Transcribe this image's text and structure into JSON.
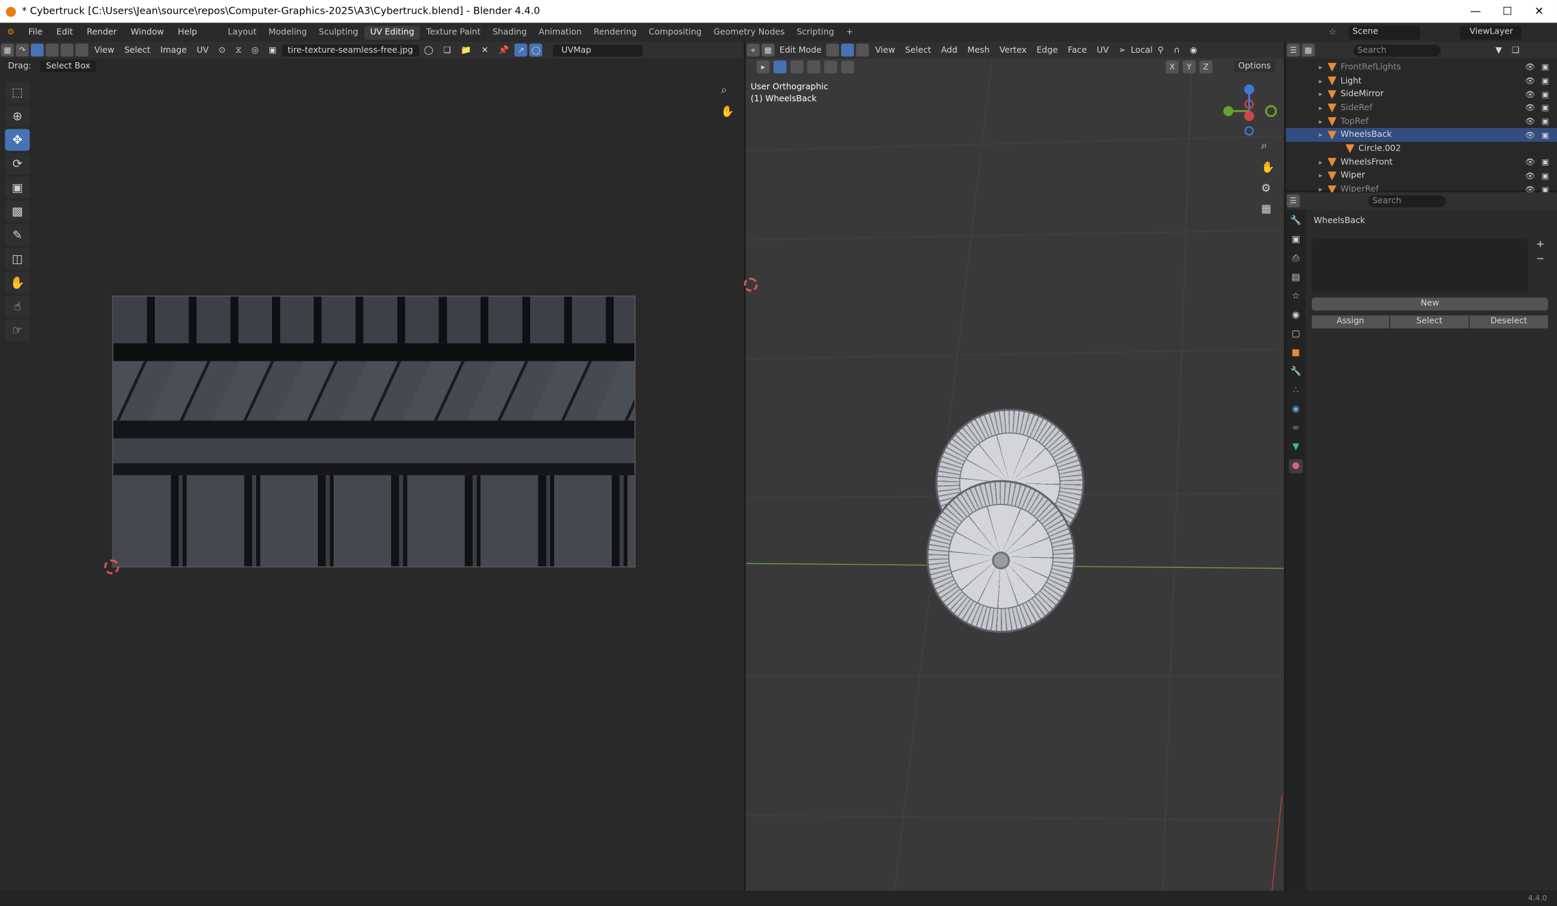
{
  "title": {
    "text": "* Cybertruck [C:\\Users\\Jean\\source\\repos\\Computer-Graphics-2025\\A3\\Cybertruck.blend] - Blender 4.4.0"
  },
  "menus": [
    "File",
    "Edit",
    "Render",
    "Window",
    "Help"
  ],
  "workspaces": [
    "Layout",
    "Modeling",
    "Sculpting",
    "UV Editing",
    "Texture Paint",
    "Shading",
    "Animation",
    "Rendering",
    "Compositing",
    "Geometry Nodes",
    "Scripting"
  ],
  "active_workspace": "UV Editing",
  "scene": {
    "label": "Scene",
    "view_layer": "ViewLayer"
  },
  "uv_editor": {
    "menus": [
      "View",
      "Select",
      "Image",
      "UV"
    ],
    "image_name": "tire-texture-seamless-free.jpg",
    "uv_map": "UVMap",
    "drag_label": "Drag:",
    "drag_mode": "Select Box"
  },
  "viewport": {
    "mode": "Edit Mode",
    "menus": [
      "View",
      "Select",
      "Add",
      "Mesh",
      "Vertex",
      "Edge",
      "Face",
      "UV"
    ],
    "orientation": "Local",
    "axes": [
      "X",
      "Y",
      "Z"
    ],
    "options_label": "Options",
    "view_name": "User Orthographic",
    "object_label": "(1) WheelsBack"
  },
  "outliner": {
    "search_placeholder": "Search",
    "items": [
      {
        "name": "FrontRefLights",
        "dim": true
      },
      {
        "name": "Light",
        "dim": false
      },
      {
        "name": "SideMirror",
        "dim": false
      },
      {
        "name": "SideRef",
        "dim": true
      },
      {
        "name": "TopRef",
        "dim": true
      },
      {
        "name": "WheelsBack",
        "selected": true
      },
      {
        "name": "Circle.002",
        "child": true
      },
      {
        "name": "WheelsFront",
        "dim": false
      },
      {
        "name": "Wiper",
        "dim": false
      },
      {
        "name": "WiperRef",
        "dim": true
      }
    ]
  },
  "properties": {
    "search_placeholder": "Search",
    "object_name": "WheelsBack",
    "new_label": "New",
    "assign_label": "Assign",
    "select_label": "Select",
    "deselect_label": "Deselect"
  },
  "status": {
    "version": "4.4.0"
  }
}
